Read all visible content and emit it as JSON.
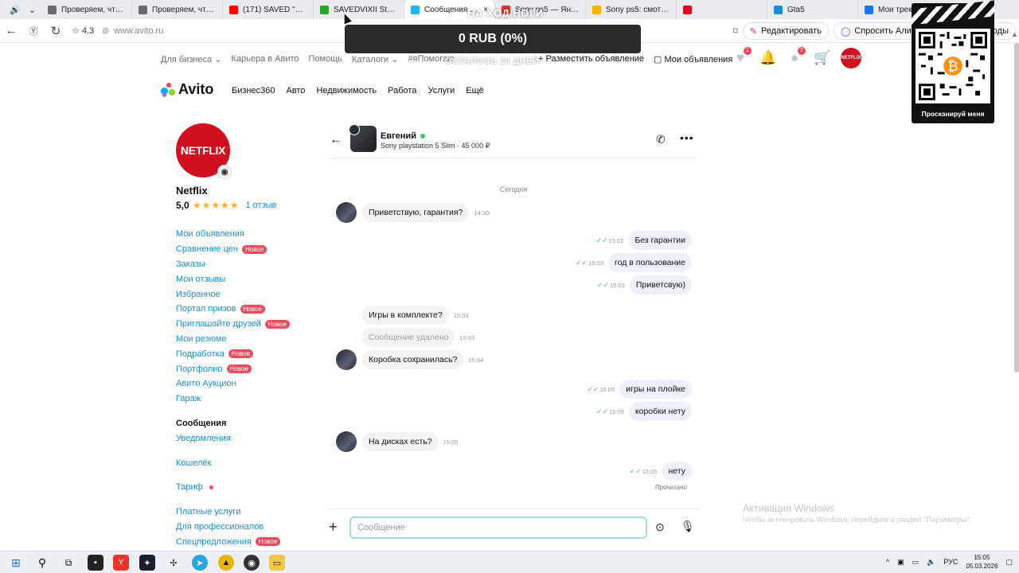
{
  "browser": {
    "tabs": [
      {
        "title": "Проверяем, что вы н",
        "color": "#6b6b6b"
      },
      {
        "title": "Проверяем, что вы н",
        "color": "#6b6b6b"
      },
      {
        "title": "(171) SAVED \"ИЗГНА",
        "color": "#ff0000"
      },
      {
        "title": "SAVEDVIXII Stream -",
        "color": "#2aa52a"
      },
      {
        "title": "Сообщения | Ави",
        "color": "#1fb5e8",
        "active": true
      },
      {
        "title": "Sony ps5 — Яндекс:",
        "color": "#e8342a"
      },
      {
        "title": "Sony ps5: смотрите ",
        "color": "#f5b400"
      },
      {
        "title": "",
        "color": "#e60023"
      },
      {
        "title": "Gta5",
        "color": "#1c8ed6"
      },
      {
        "title": "Мои треки",
        "color": "#1c75e8"
      }
    ],
    "rating": "4,3",
    "url": "www.avito.ru",
    "pills": [
      "Редактировать",
      "Спросить Алису AI",
      "Промокоды"
    ]
  },
  "overlay": {
    "title": "НА ХОД НОГИ",
    "amount": "0 RUB (0%)",
    "subtitle": "ОСТАЛОСЬ 20 ДНЕЙ"
  },
  "header": {
    "links": [
      "Для бизнеса",
      "Карьера в Авито",
      "Помощь",
      "Каталоги",
      "#яПомогаю"
    ],
    "post_ad": "+ Разместить объявление",
    "my_ads": "Мои объявления",
    "fav_badge": "1",
    "msg_badge": "3",
    "avatar_text": "NETFLIX",
    "logo": "Avito",
    "nav": [
      "Бизнес360",
      "Авто",
      "Недвижимость",
      "Работа",
      "Услуги",
      "Ещё"
    ]
  },
  "profile": {
    "avatar_text": "NETFLIX",
    "name": "Netflix",
    "rating": "5,0",
    "stars": "★★★★★",
    "reviews": "1 отзыв",
    "badge_new": "Новое",
    "menu": [
      {
        "label": "Мои объявления"
      },
      {
        "label": "Сравнение цен",
        "new": true
      },
      {
        "label": "Заказы"
      },
      {
        "label": "Мои отзывы"
      },
      {
        "label": "Избранное"
      },
      {
        "label": "Портал призов",
        "new": true
      },
      {
        "label": "Приглашайте друзей",
        "new": true
      },
      {
        "label": "Мои резюме"
      },
      {
        "label": "Подработка",
        "new": true
      },
      {
        "label": "Портфолио",
        "new": true
      },
      {
        "label": "Авито Аукцион"
      },
      {
        "label": "Гараж"
      }
    ],
    "menu2": [
      "Сообщения",
      "Уведомления"
    ],
    "wallet": "Кошелёк",
    "tariff": "Тариф",
    "menu3": [
      "Платные услуги",
      "Для профессионалов",
      "Спецпредложения"
    ]
  },
  "chat": {
    "seller": "Евгений",
    "listing": "Sony playstation 5 Slim · 45 000 ₽",
    "date": "Сегодня",
    "messages": [
      {
        "dir": "in",
        "text": "Приветствую, гарантия?",
        "time": "14:30"
      },
      {
        "dir": "out",
        "text": "Без гарантии",
        "time": "15:02"
      },
      {
        "dir": "out",
        "text": "год в пользование",
        "time": "15:03"
      },
      {
        "dir": "out",
        "text": "Приветсвую)",
        "time": "15:03"
      },
      {
        "dir": "in",
        "text": "Игры в комплекте?",
        "time": "15:03"
      },
      {
        "dir": "in",
        "text": "Сообщение удалено",
        "time": "15:03",
        "deleted": true
      },
      {
        "dir": "in",
        "text": "Коробка сохранилась?",
        "time": "15:04"
      },
      {
        "dir": "out",
        "text": "игры на  плойке",
        "time": "15:05"
      },
      {
        "dir": "out",
        "text": "коробки нету",
        "time": "15:05"
      },
      {
        "dir": "in",
        "text": "На дисках есть?",
        "time": "15:05"
      },
      {
        "dir": "out",
        "text": "нету",
        "time": "15:05"
      }
    ],
    "read": "Прочитано",
    "placeholder": "Сообщение"
  },
  "watermark": {
    "line1": "Активация Windows",
    "line2": "Чтобы активировать Windows, перейдите в раздел \"Параметры\"."
  },
  "qr": {
    "caption": "Просканируй меня"
  },
  "taskbar": {
    "lang": "РУС",
    "time": "15:05",
    "date": "05.03.2026"
  }
}
